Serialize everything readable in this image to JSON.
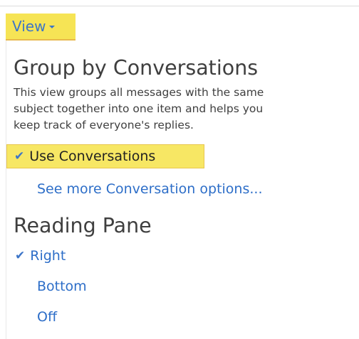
{
  "toolbar": {
    "view_label": "View"
  },
  "group_by": {
    "heading": "Group by Conversations",
    "description_lines": [
      "This view groups all messages with the same",
      "subject together into one item and helps you",
      "keep track of everyone's replies."
    ],
    "use_conversations_label": "Use Conversations",
    "use_conversations_checked": true,
    "see_more_label": "See more Conversation options..."
  },
  "reading_pane": {
    "heading": "Reading Pane",
    "options": [
      {
        "label": "Right",
        "selected": true
      },
      {
        "label": "Bottom",
        "selected": false
      },
      {
        "label": "Off",
        "selected": false
      }
    ]
  },
  "icons": {
    "check": "checkmark-icon",
    "caret": "chevron-down-icon"
  },
  "colors": {
    "highlight": "#f7e764",
    "link": "#2d6ec8",
    "text": "#3f3f3f"
  }
}
